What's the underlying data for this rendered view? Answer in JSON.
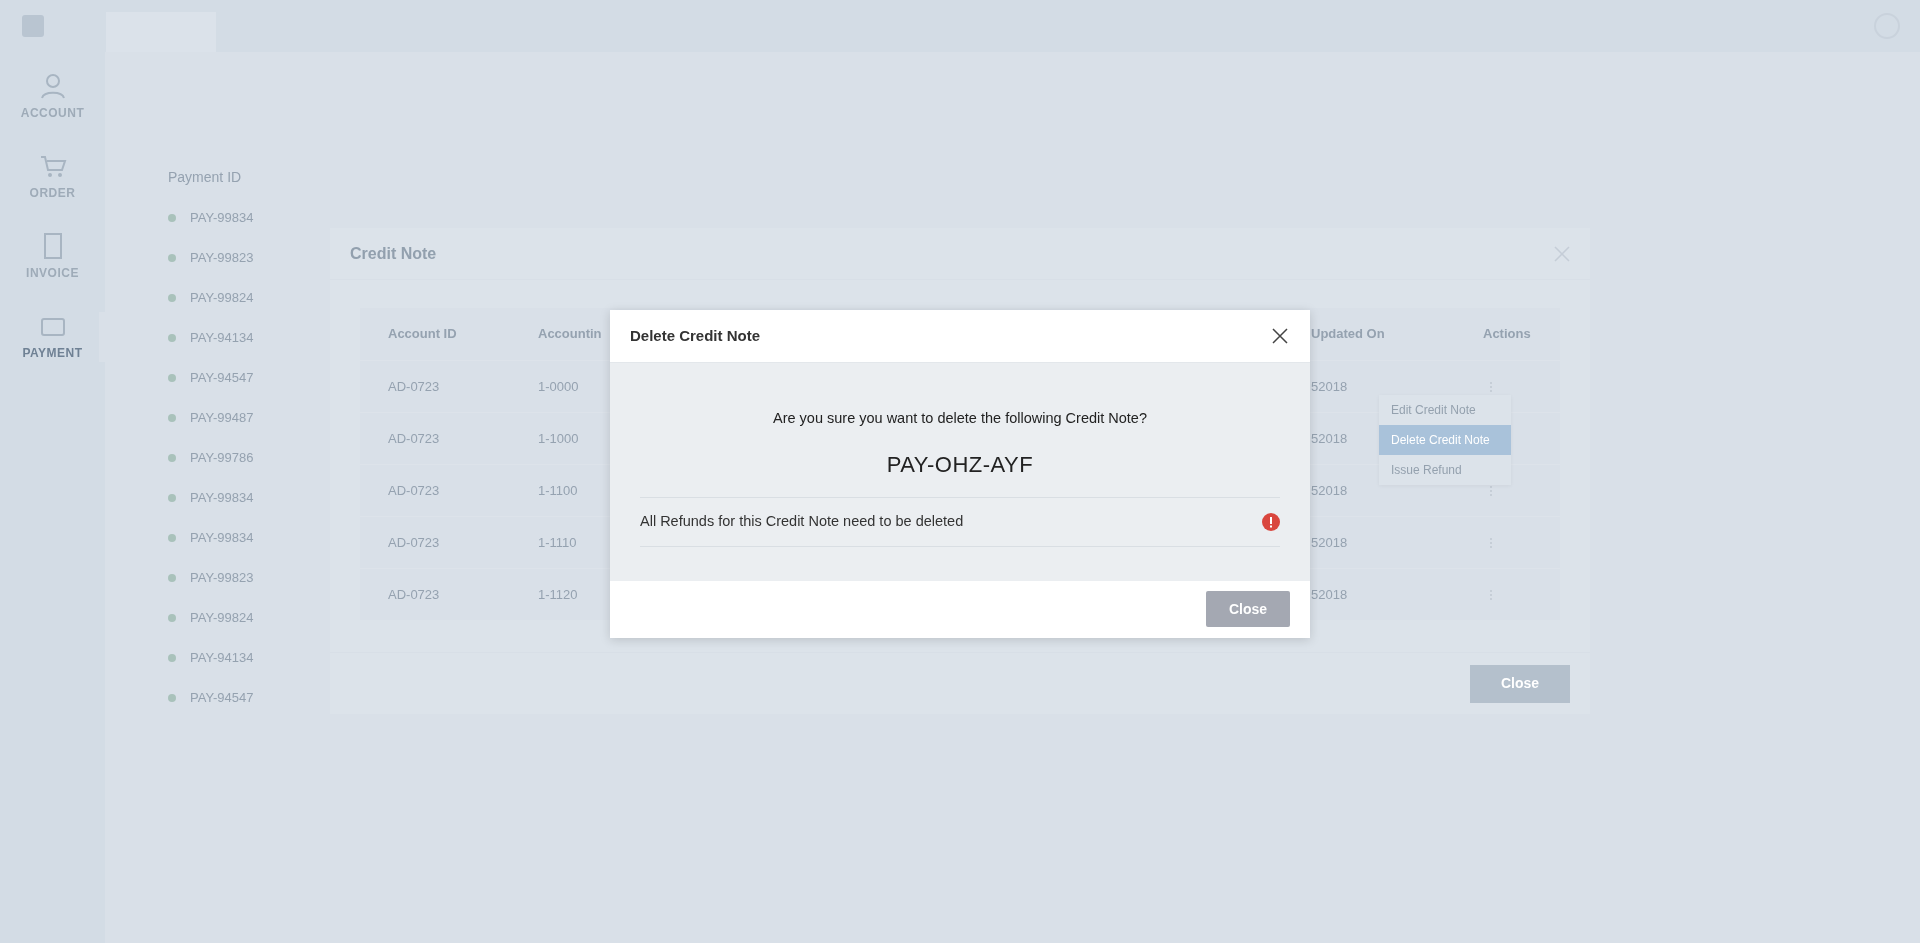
{
  "sidebar": {
    "items": [
      {
        "label": "ACCOUNT",
        "selected": false
      },
      {
        "label": "ORDER",
        "selected": false
      },
      {
        "label": "INVOICE",
        "selected": false
      },
      {
        "label": "PAYMENT",
        "selected": true
      }
    ]
  },
  "payments": {
    "header": "Payment ID",
    "items": [
      "PAY-99834",
      "PAY-99823",
      "PAY-99824",
      "PAY-94134",
      "PAY-94547",
      "PAY-99487",
      "PAY-99786",
      "PAY-99834",
      "PAY-99834",
      "PAY-99823",
      "PAY-99824",
      "PAY-94134",
      "PAY-94547"
    ]
  },
  "credit_note_dialog": {
    "title": "Credit Note",
    "columns": [
      "Account ID",
      "Accountin",
      "Updated On",
      "Actions"
    ],
    "rows": [
      {
        "account_id": "AD-0723",
        "accounting": "1-0000",
        "updated_on": "52018"
      },
      {
        "account_id": "AD-0723",
        "accounting": "1-1000",
        "updated_on": "52018"
      },
      {
        "account_id": "AD-0723",
        "accounting": "1-1100",
        "updated_on": "52018"
      },
      {
        "account_id": "AD-0723",
        "accounting": "1-1110",
        "updated_on": "52018"
      },
      {
        "account_id": "AD-0723",
        "accounting": "1-1120",
        "updated_on": "52018"
      }
    ],
    "close_button": "Close"
  },
  "context_menu": {
    "items": [
      {
        "label": "Edit Credit Note",
        "selected": false
      },
      {
        "label": "Delete Credit Note",
        "selected": true
      },
      {
        "label": "Issue Refund",
        "selected": false
      }
    ]
  },
  "delete_dialog": {
    "title": "Delete Credit Note",
    "question": "Are you sure you want to delete the following Credit Note?",
    "reference": "PAY-OHZ-AYF",
    "warning": "All Refunds for this Credit Note need to be deleted",
    "close_button": "Close"
  }
}
